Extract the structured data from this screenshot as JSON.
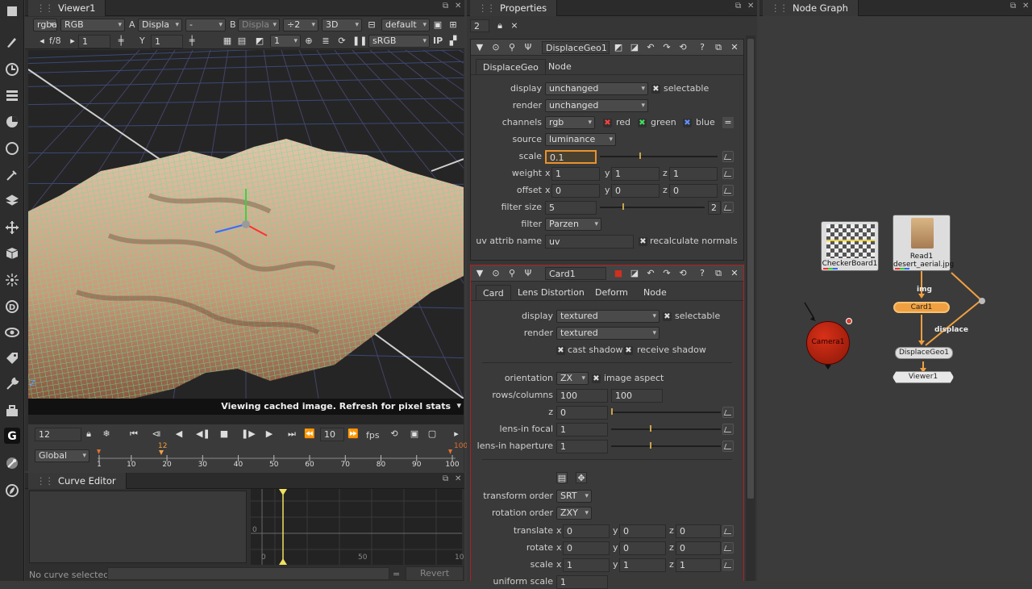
{
  "toolbar": {
    "icons": [
      "paint-brush-icon",
      "clock-icon",
      "channel-icon",
      "color-icon",
      "circle-icon",
      "filter-icon",
      "layers-icon",
      "transform-icon",
      "3d-cube-icon",
      "particles-icon",
      "deep-icon",
      "views-icon",
      "metadata-icon",
      "tools-icon",
      "toolsets-icon",
      "gizmo-icon",
      "nuke-logo-icon",
      "other-icon"
    ]
  },
  "viewer": {
    "tab": "Viewer1",
    "row1": {
      "channels": "rgba",
      "layer": "RGB",
      "a_label": "A",
      "a_input": "Displa",
      "op": "-",
      "b_label": "B",
      "b_input": "Displa",
      "downrez": "÷2",
      "mode": "3D",
      "cam": "default"
    },
    "row2": {
      "fstop": "f/8",
      "gain": "1",
      "y_label": "Y",
      "gamma": "1",
      "frame_field": "1",
      "lut": "sRGB",
      "ip": "IP"
    },
    "status": "Viewing cached image. Refresh for pixel stats",
    "timeline": {
      "frame": "12",
      "fps_value": "10",
      "fps_label": "fps",
      "range_mode": "Global",
      "marker": "12",
      "end": "100",
      "ticks": [
        "1",
        "10",
        "20",
        "30",
        "40",
        "50",
        "60",
        "70",
        "80",
        "90",
        "100"
      ]
    }
  },
  "curve_editor": {
    "tab": "Curve Editor",
    "status": "No curve selected",
    "eq": "=",
    "revert": "Revert",
    "grid_labels": [
      "0",
      "0",
      "50",
      "10"
    ]
  },
  "properties": {
    "tab": "Properties",
    "count": "2",
    "displace": {
      "name": "DisplaceGeo1",
      "tabs": [
        "DisplaceGeo",
        "Node"
      ],
      "display_label": "display",
      "display_value": "unchanged",
      "selectable": "selectable",
      "render_label": "render",
      "render_value": "unchanged",
      "channels_label": "channels",
      "channels_value": "rgb",
      "red": "red",
      "green": "green",
      "blue": "blue",
      "source_label": "source",
      "source_value": "luminance",
      "scale_label": "scale",
      "scale_value": "0.1",
      "scale_ticks": [
        "0",
        "0.1",
        "0.2",
        "0.3",
        "0.4",
        "0.5",
        "0.7",
        "1"
      ],
      "weight_label": "weight",
      "offset_label": "offset",
      "x": "x",
      "y": "y",
      "z": "z",
      "weight": [
        "1",
        "1",
        "1"
      ],
      "offset": [
        "0",
        "0",
        "0"
      ],
      "filter_size_label": "filter size",
      "filter_size_value": "5",
      "filter_size_max": "2",
      "filter_size_ticks": [
        "1",
        "10",
        "50",
        "100"
      ],
      "filter_label": "filter",
      "filter_value": "Parzen",
      "uv_label": "uv attrib name",
      "uv_value": "uv",
      "recalc": "recalculate normals"
    },
    "card": {
      "name": "Card1",
      "tabs": [
        "Card",
        "Lens Distortion",
        "Deform",
        "Node"
      ],
      "display_label": "display",
      "display_value": "textured",
      "selectable": "selectable",
      "render_label": "render",
      "render_value": "textured",
      "cast_shadow": "cast shadow",
      "receive_shadow": "receive shadow",
      "orientation_label": "orientation",
      "orientation_value": "ZX",
      "image_aspect": "image aspect",
      "rowscols_label": "rows/columns",
      "rows": "100",
      "cols": "100",
      "z_label": "z",
      "z_value": "0",
      "z_ticks": [
        "1",
        "10",
        "20",
        "30",
        "40",
        "50",
        "60",
        "70",
        "80",
        "90",
        "100"
      ],
      "lens_focal_label": "lens-in focal",
      "lens_focal_value": "1",
      "lens_ticks": [
        "0.1",
        "0.2",
        "0.5",
        "1",
        "2",
        "3",
        "4",
        "5",
        "6",
        "7",
        "8",
        "9",
        "10"
      ],
      "lens_hap_label": "lens-in haperture",
      "lens_hap_value": "1",
      "transform_order_label": "transform order",
      "transform_order_value": "SRT",
      "rotation_order_label": "rotation order",
      "rotation_order_value": "ZXY",
      "translate_label": "translate",
      "rotate_label": "rotate",
      "scale_label": "scale",
      "x": "x",
      "y": "y",
      "z": "z",
      "translate": [
        "0",
        "0",
        "0"
      ],
      "rotate": [
        "0",
        "0",
        "0"
      ],
      "scale": [
        "1",
        "1",
        "1"
      ],
      "uniform_scale_label": "uniform scale",
      "uniform_scale_value": "1"
    }
  },
  "node_graph": {
    "tab": "Node Graph",
    "nodes": {
      "checkerboard": "CheckerBoard1",
      "read_title": "Read1",
      "read_file": "desert_aerial.jpg",
      "card": "Card1",
      "camera": "Camera1",
      "displace": "DisplaceGeo1",
      "viewer": "Viewer1"
    },
    "edge_labels": {
      "img": "img",
      "displace": "displace"
    }
  },
  "colors": {
    "accent_orange": "#f0a040",
    "wire_green": "#5fe0a0",
    "camera_red": "#c0200c",
    "selection_orange": "#e8922e"
  }
}
